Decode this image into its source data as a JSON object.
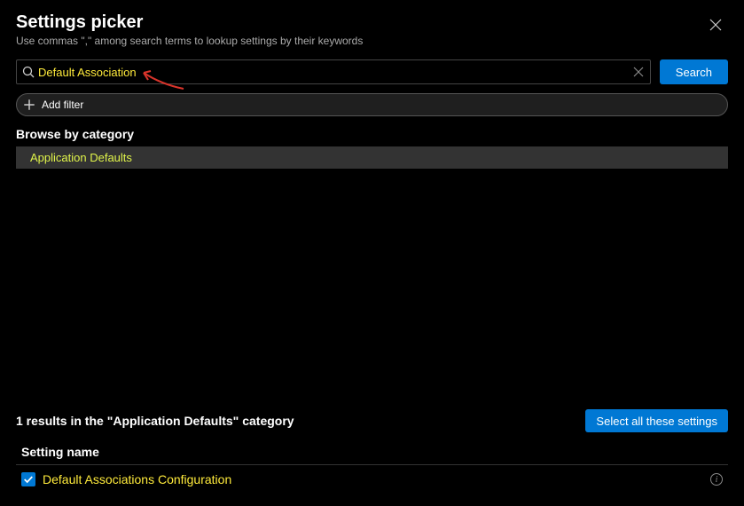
{
  "header": {
    "title": "Settings picker",
    "subtitle": "Use commas \",\" among search terms to lookup settings by their keywords"
  },
  "search": {
    "value": "Default Association",
    "button_label": "Search"
  },
  "filters": {
    "add_label": "Add filter"
  },
  "browse": {
    "section_label": "Browse by category",
    "categories": [
      {
        "label": "Application Defaults"
      }
    ]
  },
  "results": {
    "summary": "1 results in the \"Application Defaults\" category",
    "select_all_label": "Select all these settings",
    "column_header": "Setting name",
    "items": [
      {
        "name": "Default Associations Configuration",
        "checked": true
      }
    ]
  }
}
